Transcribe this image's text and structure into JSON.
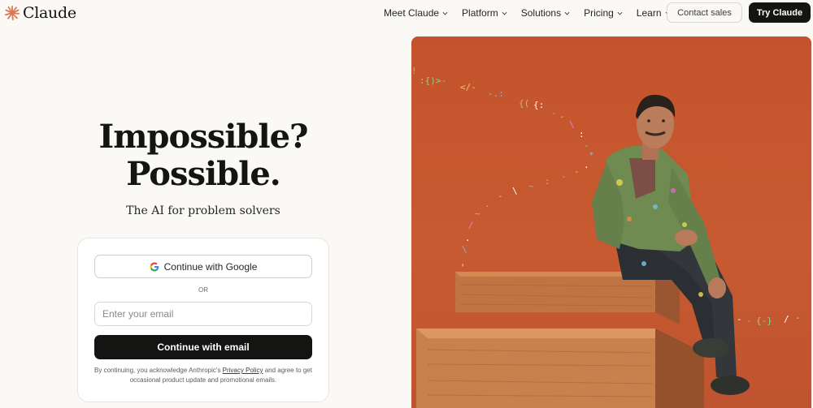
{
  "header": {
    "logo_text": "Claude",
    "logo_icon": "claude-spark-icon",
    "nav": [
      {
        "label": "Meet Claude"
      },
      {
        "label": "Platform"
      },
      {
        "label": "Solutions"
      },
      {
        "label": "Pricing"
      },
      {
        "label": "Learn"
      }
    ],
    "contact_label": "Contact sales",
    "try_label": "Try Claude"
  },
  "hero": {
    "title_line1": "Impossible?",
    "title_line2": "Possible.",
    "subtitle": "The AI for problem solvers"
  },
  "signup": {
    "google_label": "Continue with Google",
    "google_icon": "google-icon",
    "or_label": "OR",
    "email_placeholder": "Enter your email",
    "email_button_label": "Continue with email",
    "legal_prefix": "By continuing, you acknowledge Anthropic's",
    "legal_link": "Privacy Policy",
    "legal_suffix": "and agree to get occasional product update and promotional emails."
  },
  "colors": {
    "background": "#faf9f5",
    "brand_orange": "#d97757",
    "primary_dark": "#141413",
    "photo_backdrop": "#c4532b"
  }
}
